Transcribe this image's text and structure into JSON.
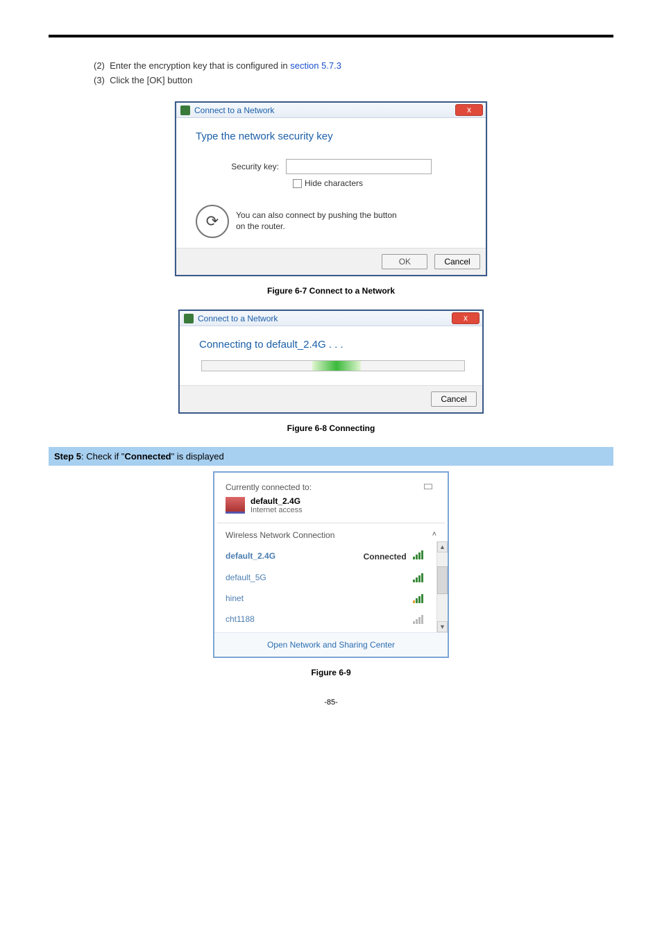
{
  "steps_upper": [
    {
      "num": "(2)",
      "text_before": "Enter the encryption key that is configured in ",
      "link": "section 5.7.3",
      "text_after": ""
    },
    {
      "num": "(3)",
      "text_before": "Click the [OK] button",
      "link": "",
      "text_after": ""
    }
  ],
  "dialog1": {
    "title": "Connect to a Network",
    "heading": "Type the network security key",
    "field_label": "Security key:",
    "hide_chars": "Hide characters",
    "router_text": "You can also connect by pushing the button on the router.",
    "ok": "OK",
    "cancel": "Cancel"
  },
  "fig1_caption": "Figure 6-7 Connect to a Network",
  "dialog2": {
    "title": "Connect to a Network",
    "heading": "Connecting to default_2.4G . . .",
    "cancel": "Cancel"
  },
  "fig2_caption": "Figure 6-8 Connecting",
  "step5": {
    "prefix": "Step 5",
    "middle": ": Check if \"",
    "bold": "Connected",
    "suffix": "\" is displayed"
  },
  "flyout": {
    "currently": "Currently connected to:",
    "net_name": "default_2.4G",
    "net_sub": "Internet access",
    "section": "Wireless Network Connection",
    "items": [
      {
        "name": "default_2.4G",
        "status": "Connected",
        "signal": "strong"
      },
      {
        "name": "default_5G",
        "status": "",
        "signal": "strong"
      },
      {
        "name": "hinet",
        "status": "",
        "signal": "orange"
      },
      {
        "name": "cht1188",
        "status": "",
        "signal": "weak"
      }
    ],
    "footer": "Open Network and Sharing Center"
  },
  "fig3_caption": "Figure 6-9",
  "page_num": "-85-"
}
